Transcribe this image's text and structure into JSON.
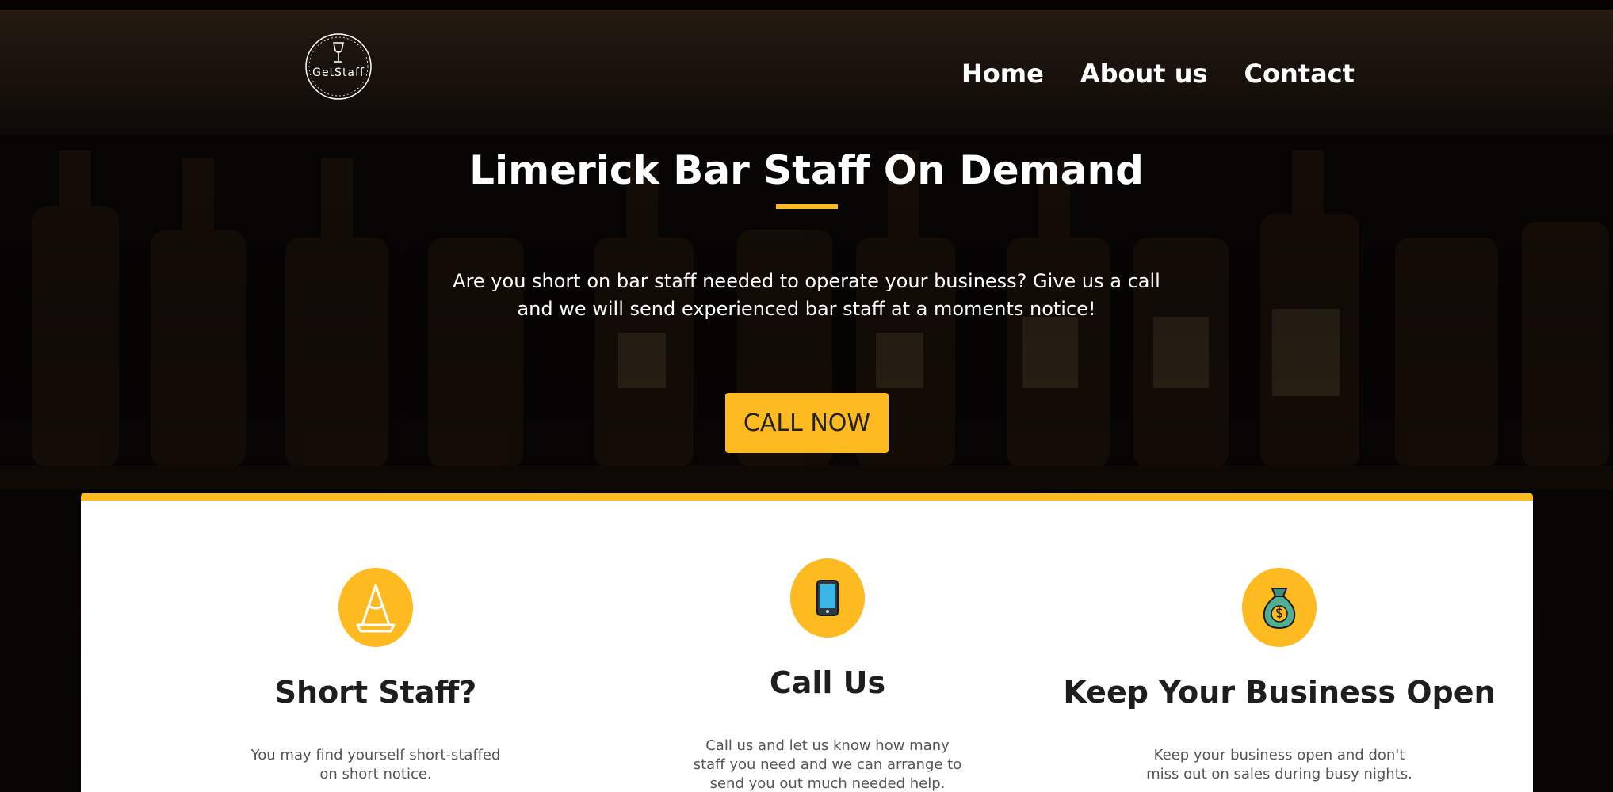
{
  "brand": {
    "logo_text": "GetStaff",
    "logo_icon": "wine-glass-icon"
  },
  "nav": {
    "items": [
      "Home",
      "About us",
      "Contact"
    ]
  },
  "hero": {
    "title": "Limerick Bar Staff On Demand",
    "subtitle": "Are you short on bar staff needed to operate your business? Give us a call and we will send experienced bar staff at a moments notice!",
    "cta_label": "CALL NOW"
  },
  "features": [
    {
      "icon": "traffic-cone-icon",
      "title": "Short Staff?",
      "text": "You may find yourself short-staffed on short notice."
    },
    {
      "icon": "mobile-phone-icon",
      "title": "Call Us",
      "text": "Call us and let us know how many staff you need and we can arrange to send you out much needed help."
    },
    {
      "icon": "money-bag-icon",
      "title": "Keep Your Business Open",
      "text": "Keep your business open and don't miss out on sales during busy nights."
    }
  ],
  "colors": {
    "accent": "#fdba21",
    "heading": "#1e1e1e",
    "body_text": "#555555"
  }
}
